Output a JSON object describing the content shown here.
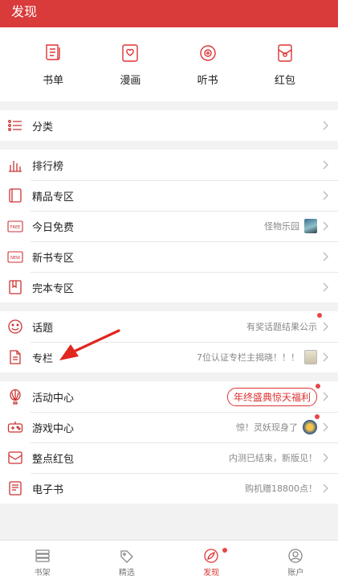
{
  "header": {
    "title": "发现"
  },
  "quick": [
    {
      "label": "书单",
      "icon": "scroll-icon"
    },
    {
      "label": "漫画",
      "icon": "comic-icon"
    },
    {
      "label": "听书",
      "icon": "disc-icon"
    },
    {
      "label": "红包",
      "icon": "red-packet-icon"
    }
  ],
  "sections": {
    "category": {
      "label": "分类"
    },
    "rank": {
      "label": "排行榜"
    },
    "premium": {
      "label": "精品专区"
    },
    "free": {
      "label": "今日免费",
      "note": "怪物乐园"
    },
    "newbook": {
      "label": "新书专区"
    },
    "finished": {
      "label": "完本专区"
    },
    "topic": {
      "label": "话题",
      "note": "有奖话题结果公示"
    },
    "column": {
      "label": "专栏",
      "note": "7位认证专栏主揭晓！！！"
    },
    "activity": {
      "label": "活动中心",
      "note": "年终盛典惊天福利"
    },
    "game": {
      "label": "游戏中心",
      "note": "惊！灵妖现身了"
    },
    "packet": {
      "label": "整点红包",
      "note": "内测已结束，新版见！"
    },
    "ebook": {
      "label": "电子书",
      "note": "购机赠18800点！"
    }
  },
  "tabs": [
    {
      "label": "书架"
    },
    {
      "label": "精选"
    },
    {
      "label": "发现"
    },
    {
      "label": "账户"
    }
  ],
  "colors": {
    "accent": "#d93a3a",
    "badge": "#e84545"
  }
}
